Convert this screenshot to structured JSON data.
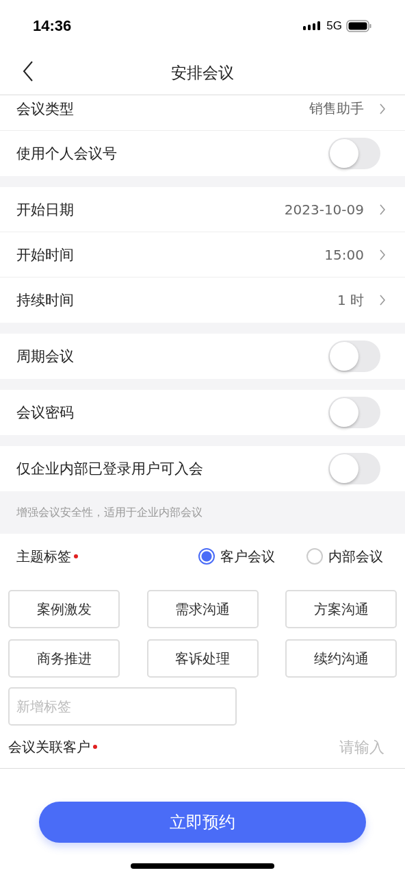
{
  "status_bar": {
    "time": "14:36",
    "network": "5G"
  },
  "nav": {
    "title": "安排会议"
  },
  "sections": [
    {
      "rows": [
        {
          "kind": "value",
          "label": "会议类型",
          "value": "销售助手"
        },
        {
          "kind": "switch",
          "label": "使用个人会议号",
          "on": false
        }
      ]
    },
    {
      "rows": [
        {
          "kind": "value",
          "label": "开始日期",
          "value": "2023-10-09"
        },
        {
          "kind": "value",
          "label": "开始时间",
          "value": "15:00"
        },
        {
          "kind": "value",
          "label": "持续时间",
          "value": "1 时"
        }
      ]
    },
    {
      "rows": [
        {
          "kind": "switch",
          "label": "周期会议",
          "on": false
        }
      ]
    },
    {
      "rows": [
        {
          "kind": "switch",
          "label": "会议密码",
          "on": false
        }
      ]
    },
    {
      "rows": [
        {
          "kind": "switch",
          "label": "仅企业内部已登录用户可入会",
          "on": false
        }
      ],
      "hint": "增强会议安全性，适用于企业内部会议"
    }
  ],
  "topic": {
    "label": "主题标签",
    "required": true,
    "options": [
      {
        "label": "客户会议",
        "selected": true
      },
      {
        "label": "内部会议",
        "selected": false
      }
    ],
    "tags": [
      "案例激发",
      "需求沟通",
      "方案沟通",
      "商务推进",
      "客诉处理",
      "续约沟通"
    ],
    "new_tag": {
      "placeholder": "新增标签"
    }
  },
  "customer": {
    "label": "会议关联客户",
    "required": true,
    "placeholder": "请输入"
  },
  "submit": "立即预约"
}
